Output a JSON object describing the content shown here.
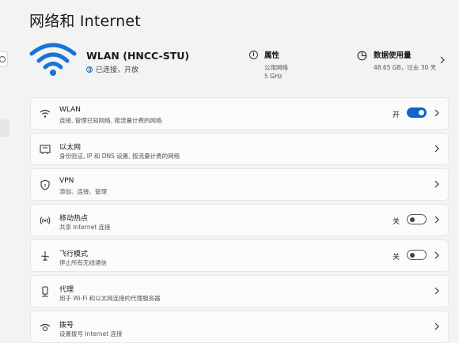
{
  "page": {
    "title": "网络和 Internet"
  },
  "network": {
    "name": "WLAN (HNCC-STU)",
    "status": "已连接，开放"
  },
  "properties": {
    "title": "属性",
    "line1": "公用网络",
    "line2": "5 GHz"
  },
  "data_usage": {
    "title": "数据使用量",
    "detail": "48.65 GB，过去 30 天"
  },
  "settings": [
    {
      "title": "WLAN",
      "desc": "连接, 管理已知网络, 按流量计费的网络",
      "icon": "wifi-icon",
      "toggle": true,
      "state": "开",
      "on": true
    },
    {
      "title": "以太网",
      "desc": "身份验证, IP 和 DNS 设置, 按流量计费的网络",
      "icon": "ethernet-icon",
      "toggle": false
    },
    {
      "title": "VPN",
      "desc": "添加、连接、管理",
      "icon": "shield-icon",
      "toggle": false
    },
    {
      "title": "移动热点",
      "desc": "共享 Internet 连接",
      "icon": "hotspot-icon",
      "toggle": true,
      "state": "关",
      "on": false
    },
    {
      "title": "飞行模式",
      "desc": "停止所有无线通信",
      "icon": "airplane-icon",
      "toggle": true,
      "state": "关",
      "on": false
    },
    {
      "title": "代理",
      "desc": "用于 Wi-Fi 和以太网连接的代理服务器",
      "icon": "proxy-icon",
      "toggle": false
    },
    {
      "title": "拨号",
      "desc": "设置拨号 Internet 连接",
      "icon": "dialup-icon",
      "toggle": false
    }
  ],
  "colors": {
    "accent": "#0f64c8",
    "wifi_hero": "#1a73d8",
    "background": "#f3f3f3",
    "card": "#fbfbfb"
  }
}
